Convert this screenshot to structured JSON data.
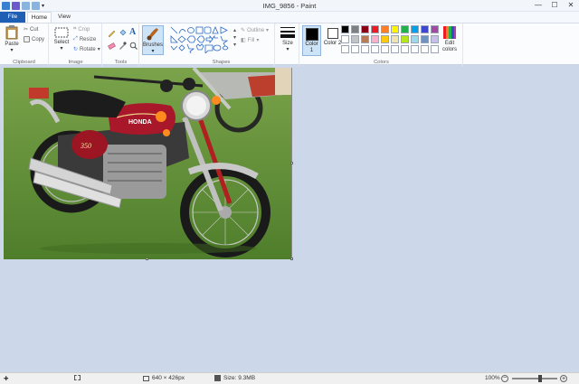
{
  "window": {
    "title": "IMG_9856 - Paint",
    "minimize": "—",
    "maximize": "☐",
    "close": "✕"
  },
  "tabs": [
    {
      "label": "File"
    },
    {
      "label": "Home"
    },
    {
      "label": "View"
    }
  ],
  "ribbon": {
    "clipboard": {
      "label": "Clipboard",
      "paste": "Paste",
      "cut": "Cut",
      "copy": "Copy"
    },
    "image": {
      "label": "Image",
      "select": "Select",
      "crop": "Crop",
      "resize": "Resize",
      "rotate": "Rotate"
    },
    "tools": {
      "label": "Tools"
    },
    "brushes": {
      "label": "Brushes"
    },
    "shapes": {
      "label": "Shapes",
      "outline": "Outline",
      "fill": "Fill"
    },
    "size": {
      "label": "Size"
    },
    "colors": {
      "label": "Colors",
      "color1": "Color 1",
      "color2": "Color 2",
      "edit": "Edit colors",
      "palette": [
        "#000000",
        "#7f7f7f",
        "#880015",
        "#ed1c24",
        "#ff7f27",
        "#fff200",
        "#22b14c",
        "#00a2e8",
        "#3f48cc",
        "#a349a4",
        "#ffffff",
        "#c3c3c3",
        "#b97a57",
        "#ffaec9",
        "#ffc90e",
        "#efe4b0",
        "#b5e61d",
        "#99d9ea",
        "#7092be",
        "#c8bfe7",
        "#ffffff",
        "#ffffff",
        "#ffffff",
        "#ffffff",
        "#ffffff",
        "#ffffff",
        "#ffffff",
        "#ffffff",
        "#ffffff",
        "#ffffff"
      ]
    }
  },
  "status": {
    "dimensions": "640 × 426px",
    "size": "Size: 9.3MB",
    "zoom": "100%"
  },
  "image": {
    "brand": "HONDA"
  }
}
